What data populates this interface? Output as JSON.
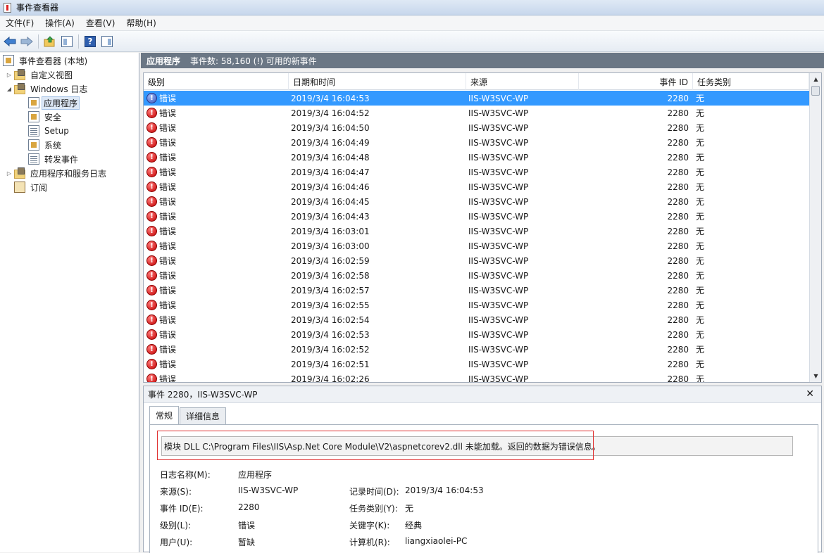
{
  "window": {
    "title": "事件查看器"
  },
  "menu": [
    "文件(F)",
    "操作(A)",
    "查看(V)",
    "帮助(H)"
  ],
  "toolbar": {
    "icons": [
      "back-arrow-icon",
      "forward-arrow-icon",
      "up-folder-icon",
      "show-tree-icon",
      "help-icon",
      "show-action-pane-icon"
    ]
  },
  "tree": {
    "root": "事件查看器 (本地)",
    "custom_views": "自定义视图",
    "windows_logs": "Windows 日志",
    "application": "应用程序",
    "security": "安全",
    "setup": "Setup",
    "system": "系统",
    "forwarded": "转发事件",
    "app_service_logs": "应用程序和服务日志",
    "subscriptions": "订阅"
  },
  "header": {
    "title": "应用程序",
    "summary": "事件数: 58,160 (!) 可用的新事件"
  },
  "columns": {
    "level": "级别",
    "datetime": "日期和时间",
    "source": "来源",
    "event_id": "事件 ID",
    "task": "任务类别"
  },
  "rows": [
    {
      "level": "错误",
      "datetime": "2019/3/4 16:04:53",
      "source": "IIS-W3SVC-WP",
      "event_id": "2280",
      "task": "无"
    },
    {
      "level": "错误",
      "datetime": "2019/3/4 16:04:52",
      "source": "IIS-W3SVC-WP",
      "event_id": "2280",
      "task": "无"
    },
    {
      "level": "错误",
      "datetime": "2019/3/4 16:04:50",
      "source": "IIS-W3SVC-WP",
      "event_id": "2280",
      "task": "无"
    },
    {
      "level": "错误",
      "datetime": "2019/3/4 16:04:49",
      "source": "IIS-W3SVC-WP",
      "event_id": "2280",
      "task": "无"
    },
    {
      "level": "错误",
      "datetime": "2019/3/4 16:04:48",
      "source": "IIS-W3SVC-WP",
      "event_id": "2280",
      "task": "无"
    },
    {
      "level": "错误",
      "datetime": "2019/3/4 16:04:47",
      "source": "IIS-W3SVC-WP",
      "event_id": "2280",
      "task": "无"
    },
    {
      "level": "错误",
      "datetime": "2019/3/4 16:04:46",
      "source": "IIS-W3SVC-WP",
      "event_id": "2280",
      "task": "无"
    },
    {
      "level": "错误",
      "datetime": "2019/3/4 16:04:45",
      "source": "IIS-W3SVC-WP",
      "event_id": "2280",
      "task": "无"
    },
    {
      "level": "错误",
      "datetime": "2019/3/4 16:04:43",
      "source": "IIS-W3SVC-WP",
      "event_id": "2280",
      "task": "无"
    },
    {
      "level": "错误",
      "datetime": "2019/3/4 16:03:01",
      "source": "IIS-W3SVC-WP",
      "event_id": "2280",
      "task": "无"
    },
    {
      "level": "错误",
      "datetime": "2019/3/4 16:03:00",
      "source": "IIS-W3SVC-WP",
      "event_id": "2280",
      "task": "无"
    },
    {
      "level": "错误",
      "datetime": "2019/3/4 16:02:59",
      "source": "IIS-W3SVC-WP",
      "event_id": "2280",
      "task": "无"
    },
    {
      "level": "错误",
      "datetime": "2019/3/4 16:02:58",
      "source": "IIS-W3SVC-WP",
      "event_id": "2280",
      "task": "无"
    },
    {
      "level": "错误",
      "datetime": "2019/3/4 16:02:57",
      "source": "IIS-W3SVC-WP",
      "event_id": "2280",
      "task": "无"
    },
    {
      "level": "错误",
      "datetime": "2019/3/4 16:02:55",
      "source": "IIS-W3SVC-WP",
      "event_id": "2280",
      "task": "无"
    },
    {
      "level": "错误",
      "datetime": "2019/3/4 16:02:54",
      "source": "IIS-W3SVC-WP",
      "event_id": "2280",
      "task": "无"
    },
    {
      "level": "错误",
      "datetime": "2019/3/4 16:02:53",
      "source": "IIS-W3SVC-WP",
      "event_id": "2280",
      "task": "无"
    },
    {
      "level": "错误",
      "datetime": "2019/3/4 16:02:52",
      "source": "IIS-W3SVC-WP",
      "event_id": "2280",
      "task": "无"
    },
    {
      "level": "错误",
      "datetime": "2019/3/4 16:02:51",
      "source": "IIS-W3SVC-WP",
      "event_id": "2280",
      "task": "无"
    },
    {
      "level": "错误",
      "datetime": "2019/3/4 16:02:26",
      "source": "IIS-W3SVC-WP",
      "event_id": "2280",
      "task": "无"
    }
  ],
  "detail": {
    "title": "事件 2280，IIS-W3SVC-WP",
    "tab_general": "常规",
    "tab_details": "详细信息",
    "message": "模块 DLL C:\\Program Files\\IIS\\Asp.Net Core Module\\V2\\aspnetcorev2.dll 未能加载。返回的数据为错误信息。",
    "log_name_label": "日志名称(M):",
    "log_name": "应用程序",
    "source_label": "来源(S):",
    "source": "IIS-W3SVC-WP",
    "logged_label": "记录时间(D):",
    "logged": "2019/3/4 16:04:53",
    "event_id_label": "事件 ID(E):",
    "event_id": "2280",
    "task_label": "任务类别(Y):",
    "task": "无",
    "level_label": "级别(L):",
    "level": "错误",
    "keywords_label": "关键字(K):",
    "keywords": "经典",
    "user_label": "用户(U):",
    "user": "暂缺",
    "computer_label": "计算机(R):",
    "computer": "liangxiaolei-PC"
  }
}
